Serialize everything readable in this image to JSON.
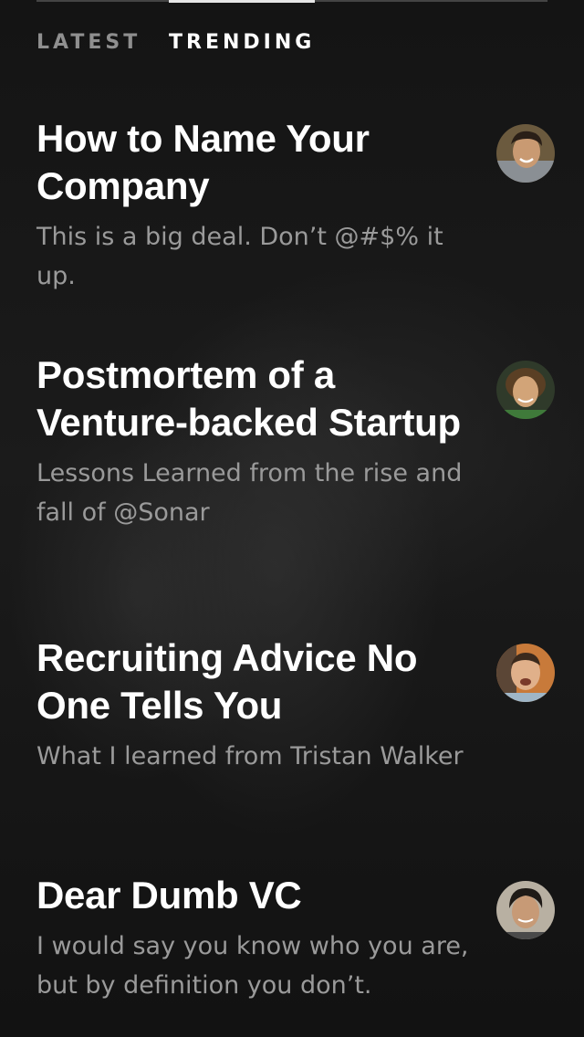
{
  "tabs": {
    "latest": "LATEST",
    "trending": "TRENDING",
    "active": "trending"
  },
  "articles": [
    {
      "title": "How to Name Your Company",
      "subtitle": "This is a big deal. Don’t @#$% it up.",
      "avatar_icon": "author-avatar"
    },
    {
      "title": "Postmortem of a Venture-backed Startup",
      "subtitle": "Lessons Learned from the rise and fall of @Sonar",
      "avatar_icon": "author-avatar"
    },
    {
      "title": "Recruiting Advice No One Tells You",
      "subtitle": "What I learned from Tristan Walker",
      "avatar_icon": "author-avatar"
    },
    {
      "title": "Dear Dumb VC",
      "subtitle": "I would say you know who you are, but by definition you don’t.",
      "avatar_icon": "author-avatar"
    }
  ],
  "colors": {
    "background": "#151515",
    "title": "#ffffff",
    "subtitle": "#9a9a9a",
    "tab_inactive": "#8f8f8f",
    "tab_active": "#ffffff"
  }
}
